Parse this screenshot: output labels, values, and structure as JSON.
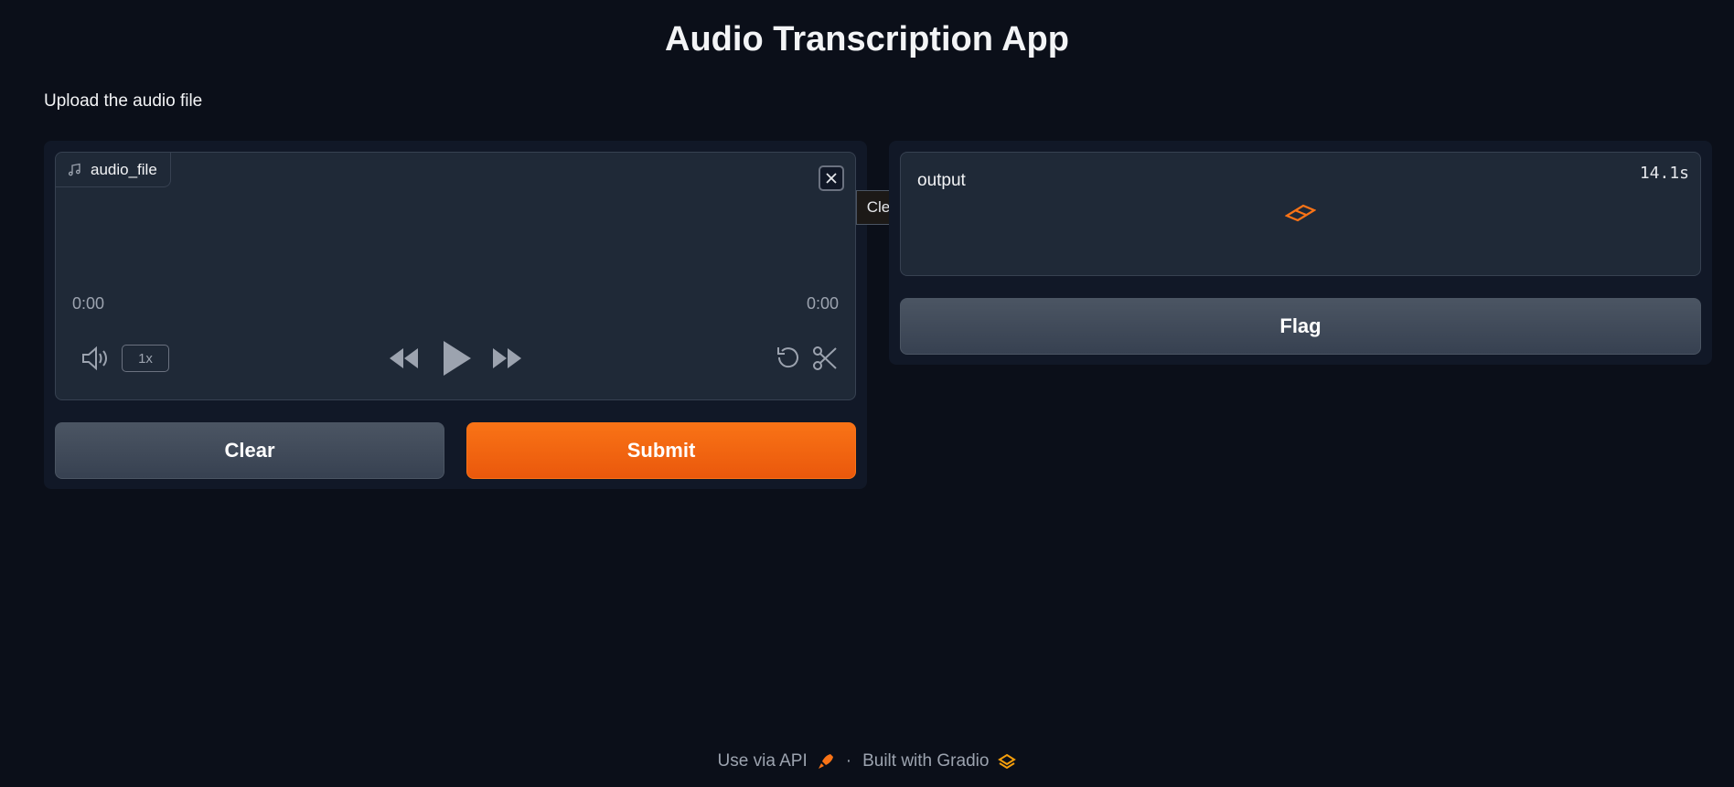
{
  "header": {
    "title": "Audio Transcription App"
  },
  "description": "Upload the audio file",
  "audio_input": {
    "label": "audio_file",
    "time_start": "0:00",
    "time_end": "0:00",
    "speed": "1x"
  },
  "actions": {
    "clear_label": "Clear",
    "submit_label": "Submit"
  },
  "tooltip": {
    "text": "Clear"
  },
  "output": {
    "label": "output",
    "timer": "14.1s"
  },
  "flag": {
    "label": "Flag"
  },
  "footer": {
    "api_label": "Use via API",
    "separator": "·",
    "built_label": "Built with Gradio"
  },
  "colors": {
    "accent": "#f97316",
    "background": "#0b0f19",
    "panel": "#111827",
    "block": "#1f2937"
  }
}
